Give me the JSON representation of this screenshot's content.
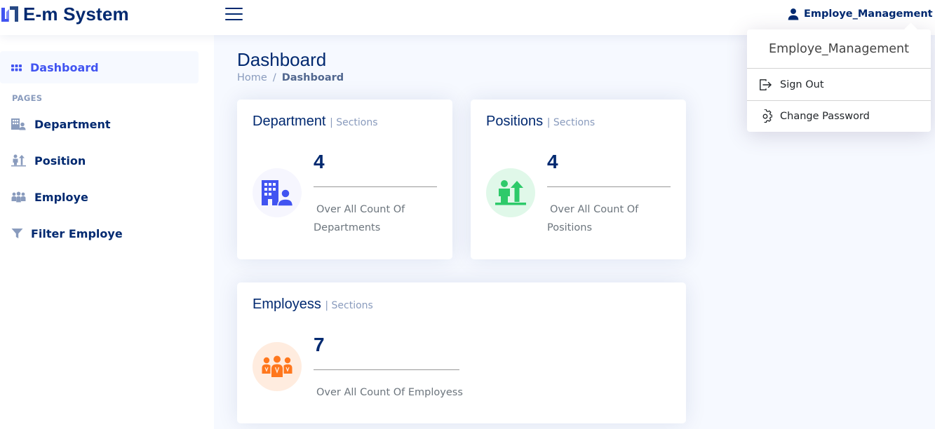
{
  "app": {
    "logo_text": "E-m System"
  },
  "header": {
    "user_name": "Employe_Management"
  },
  "dropdown": {
    "header": "Employe_Management",
    "items": [
      {
        "label": "Sign Out",
        "icon": "sign-out-icon"
      },
      {
        "label": "Change Password",
        "icon": "gear-icon"
      }
    ]
  },
  "sidebar": {
    "dashboard": {
      "label": "Dashboard",
      "icon": "grid-icon",
      "active": true
    },
    "heading": "PAGES",
    "items": [
      {
        "label": "Department",
        "icon": "building-icon"
      },
      {
        "label": "Position",
        "icon": "person-up-arrow-icon"
      },
      {
        "label": "Employe",
        "icon": "people-icon"
      },
      {
        "label": "Filter Employe",
        "icon": "filter-icon"
      }
    ]
  },
  "page": {
    "title": "Dashboard",
    "breadcrumb": [
      "Home",
      "Dashboard"
    ],
    "breadcrumb_separator": "/"
  },
  "cards": [
    {
      "title": "Department",
      "subtitle": "| Sections",
      "value": "4",
      "description_line1": "Over All Count Of",
      "description_line2": "Departments",
      "icon": "building-person-icon",
      "icon_color": "#4154f1",
      "icon_bg": "#f6f6fe"
    },
    {
      "title": "Positions",
      "subtitle": "| Sections",
      "value": "4",
      "description_line1": "Over All Count Of",
      "description_line2": "Positions",
      "icon": "person-arrow-up-icon",
      "icon_color": "#2eca6a",
      "icon_bg": "#e0f8e9"
    },
    {
      "title": "Employess",
      "subtitle": "| Sections",
      "value": "7",
      "description_line1": "Over All Count Of Employess",
      "icon": "people-group-icon",
      "icon_color": "#ff771d",
      "icon_bg": "#ffecdf"
    }
  ],
  "colors": {
    "brand": "#012970",
    "accent": "#4154f1",
    "background": "#f6f9ff",
    "muted": "#899bbd"
  }
}
